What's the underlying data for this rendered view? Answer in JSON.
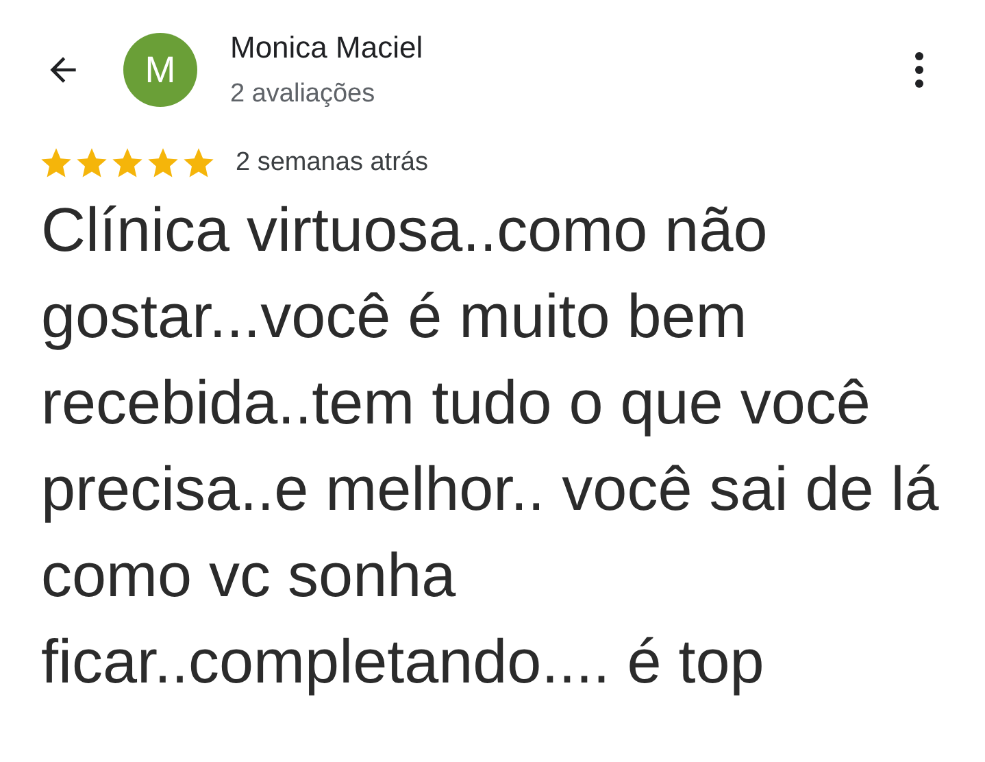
{
  "reviewer": {
    "initial": "M",
    "name": "Monica Maciel",
    "reviews": "2 avaliações"
  },
  "review": {
    "stars": 5,
    "time": "2 semanas atrás",
    "text": "Clínica virtuosa..como não gostar...você é muito bem recebida..tem tudo o que você precisa..e melhor.. você sai de lá como vc sonha ficar..completando.... é top"
  }
}
